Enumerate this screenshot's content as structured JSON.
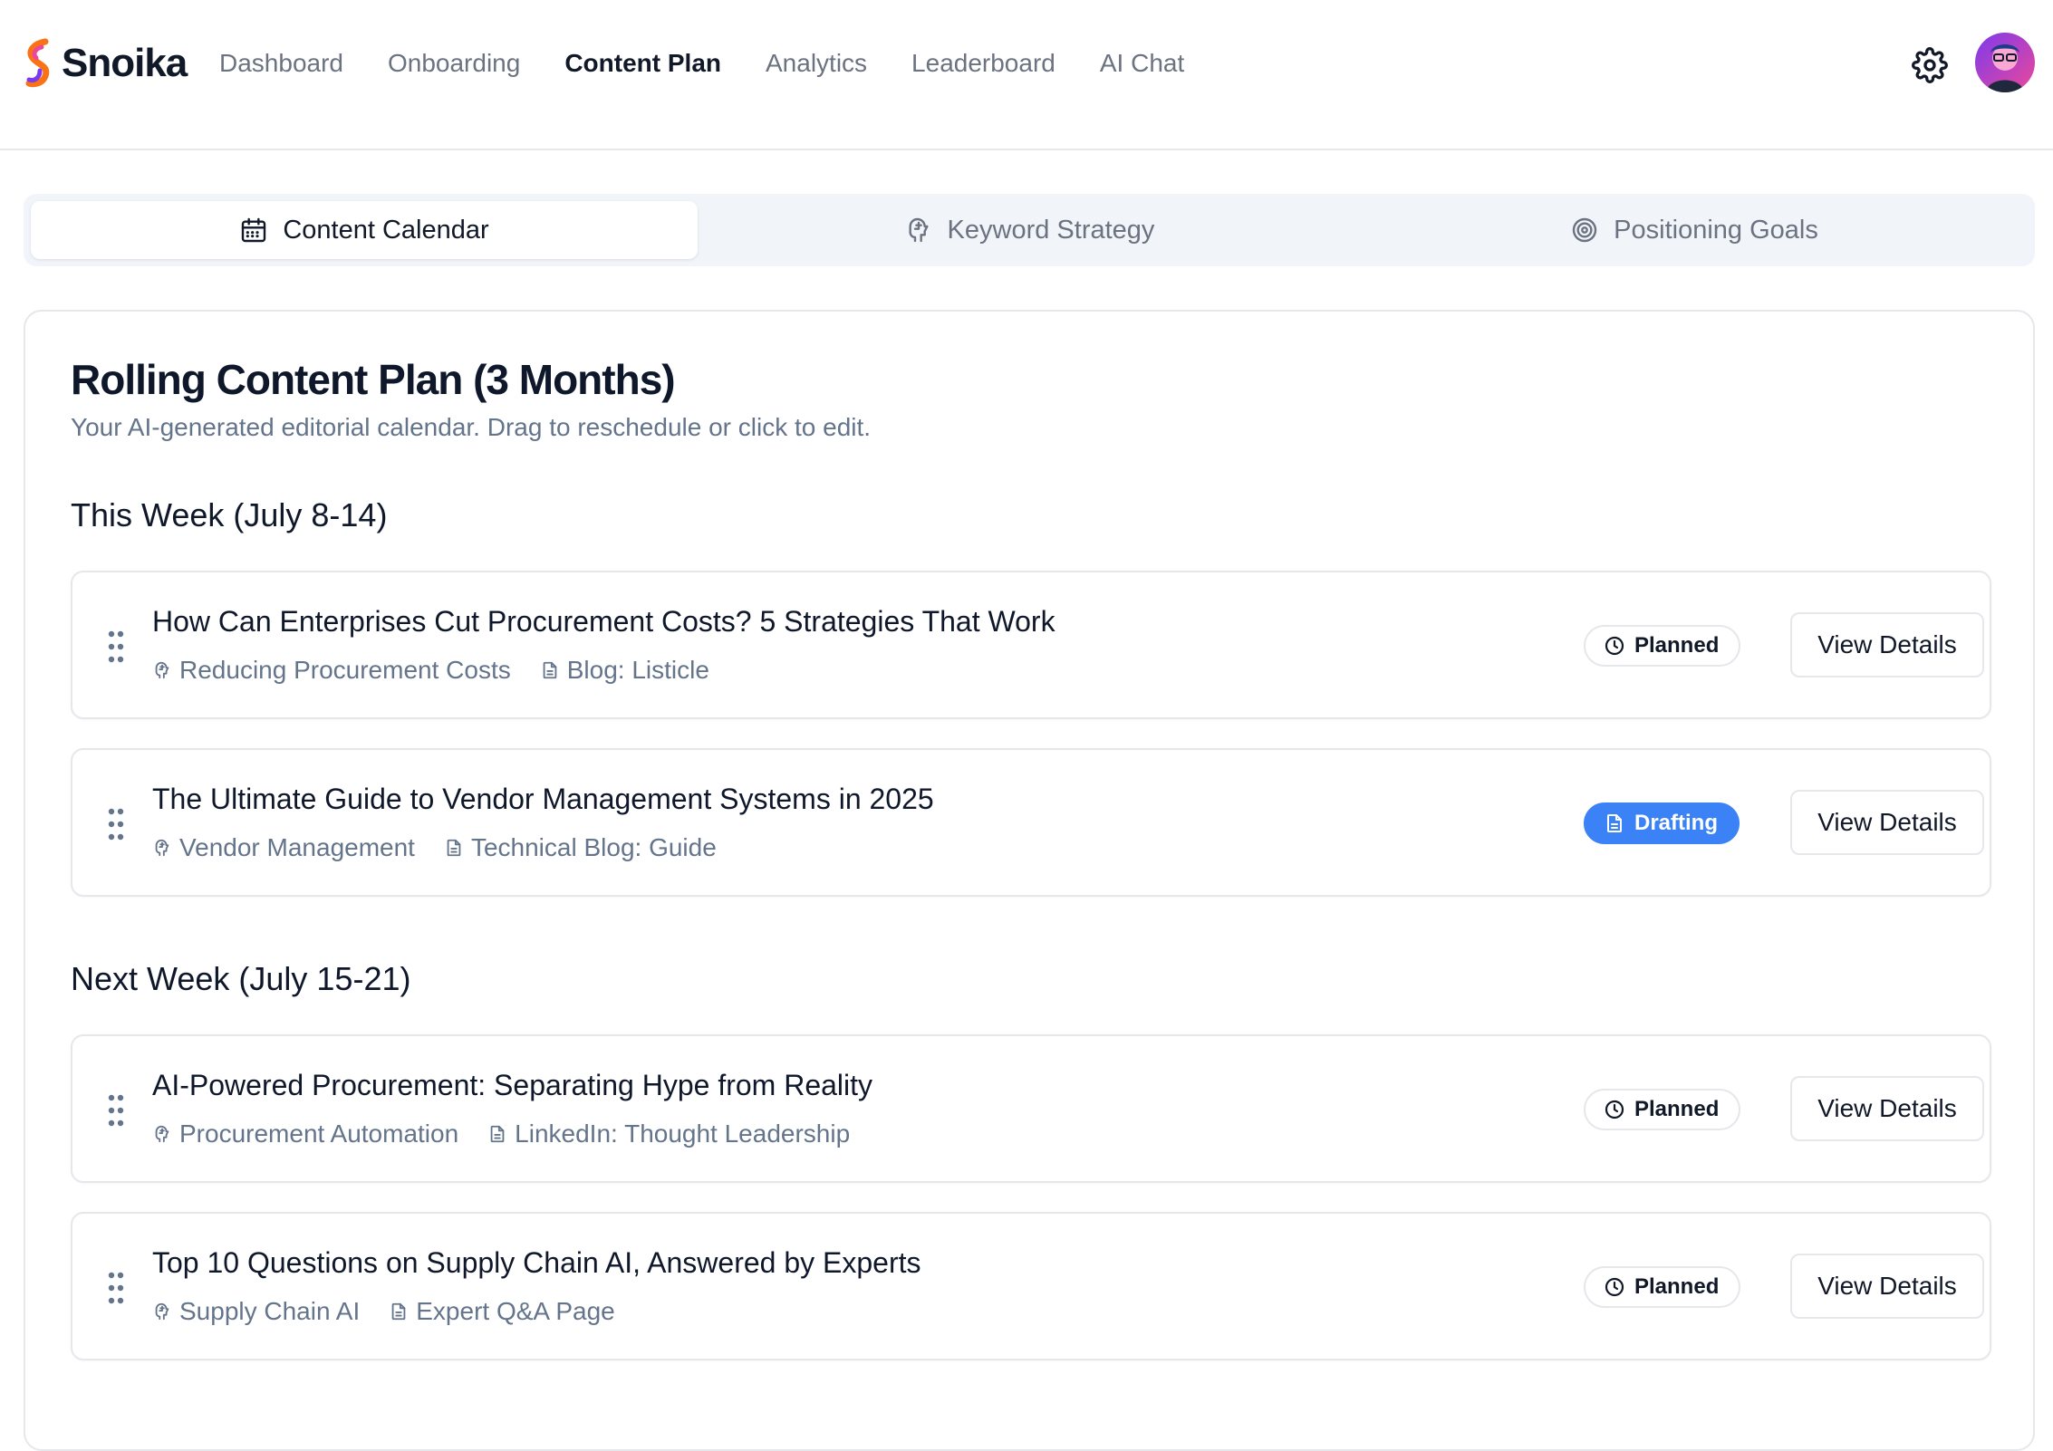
{
  "brand": {
    "name": "Snoika"
  },
  "nav": {
    "items": [
      {
        "label": "Dashboard"
      },
      {
        "label": "Onboarding"
      },
      {
        "label": "Content Plan"
      },
      {
        "label": "Analytics"
      },
      {
        "label": "Leaderboard"
      },
      {
        "label": "AI Chat"
      }
    ],
    "active": "Content Plan"
  },
  "tabs": [
    {
      "label": "Content Calendar",
      "icon": "calendar-icon"
    },
    {
      "label": "Keyword Strategy",
      "icon": "brain-icon"
    },
    {
      "label": "Positioning Goals",
      "icon": "target-icon"
    }
  ],
  "main": {
    "title": "Rolling Content Plan (3 Months)",
    "subtitle": "Your AI-generated editorial calendar. Drag to reschedule or click to edit.",
    "view_label": "View Details",
    "weeks": [
      {
        "heading": "This Week (July 8-14)",
        "items": [
          {
            "title": "How Can Enterprises Cut Procurement Costs? 5 Strategies That Work",
            "keyword": "Reducing Procurement Costs",
            "format": "Blog: Listicle",
            "status": "Planned"
          },
          {
            "title": "The Ultimate Guide to Vendor Management Systems in 2025",
            "keyword": "Vendor Management",
            "format": "Technical Blog: Guide",
            "status": "Drafting"
          }
        ]
      },
      {
        "heading": "Next Week (July 15-21)",
        "items": [
          {
            "title": "AI-Powered Procurement: Separating Hype from Reality",
            "keyword": "Procurement Automation",
            "format": "LinkedIn: Thought Leadership",
            "status": "Planned"
          },
          {
            "title": "Top 10 Questions on Supply Chain AI, Answered by Experts",
            "keyword": "Supply Chain AI",
            "format": "Expert Q&A Page",
            "status": "Planned"
          }
        ]
      }
    ]
  },
  "colors": {
    "accent": "#3b82f6",
    "muted": "#64748b",
    "border": "#e5e7eb",
    "tabs_bg": "#f1f5f9"
  }
}
